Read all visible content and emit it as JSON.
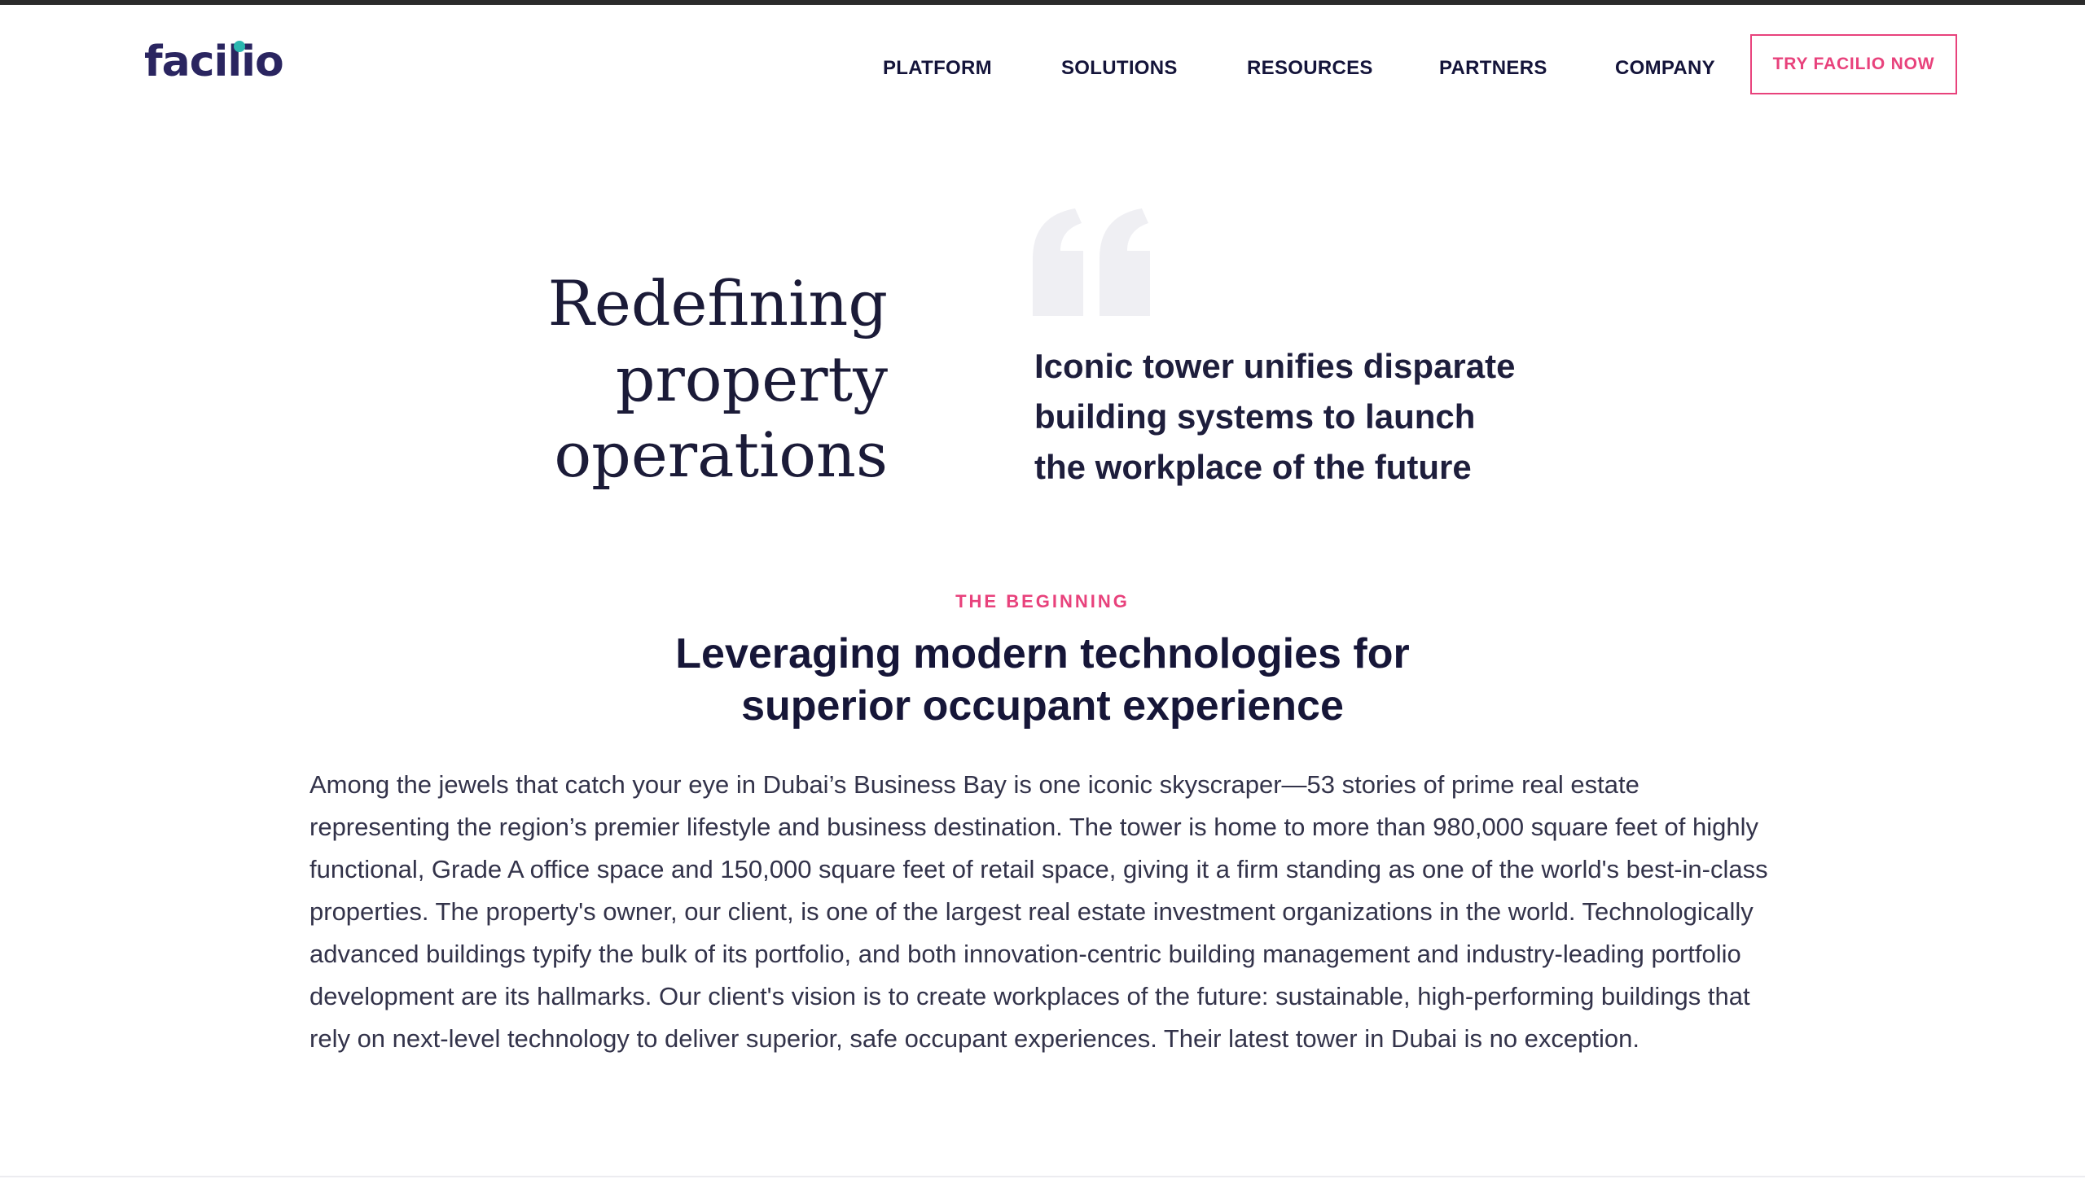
{
  "header": {
    "logo_text": "facilio",
    "nav": [
      {
        "label": "PLATFORM"
      },
      {
        "label": "SOLUTIONS"
      },
      {
        "label": "RESOURCES"
      },
      {
        "label": "PARTNERS"
      },
      {
        "label": "COMPANY"
      }
    ],
    "cta_label": "TRY FACILIO NOW"
  },
  "hero": {
    "title_lines": [
      "Redefining",
      "property",
      "operations"
    ],
    "quote_lines": [
      "Iconic tower unifies disparate",
      "building systems to launch",
      "the workplace of the future"
    ]
  },
  "section": {
    "eyebrow": "THE BEGINNING",
    "heading_lines": [
      "Leveraging modern technologies for",
      "superior occupant experience"
    ],
    "body": "Among the jewels that catch your eye in Dubai’s Business Bay is one iconic skyscraper—53 stories of prime real estate representing the region’s premier lifestyle and business destination. The tower is home to more than 980,000 square feet of highly functional, Grade A office space and 150,000 square feet of retail space, giving it a firm standing as one of the world's best-in-class properties. The property's owner, our client, is one of the largest real estate investment organizations in the world. Technologically advanced buildings typify the bulk of its portfolio, and both innovation-centric building management and industry-leading portfolio development are its hallmarks. Our client's vision is to create workplaces of the future: sustainable, high-performing buildings that rely on next-level technology to deliver superior, safe occupant experiences. Their latest tower in Dubai is no exception."
  },
  "colors": {
    "brand_navy": "#2a2560",
    "accent_pink": "#e8427c",
    "logo_dot_teal": "#2bb7b0",
    "quote_mark_gray": "#efeff3"
  },
  "icons": {
    "quote": "open-quote-icon"
  }
}
